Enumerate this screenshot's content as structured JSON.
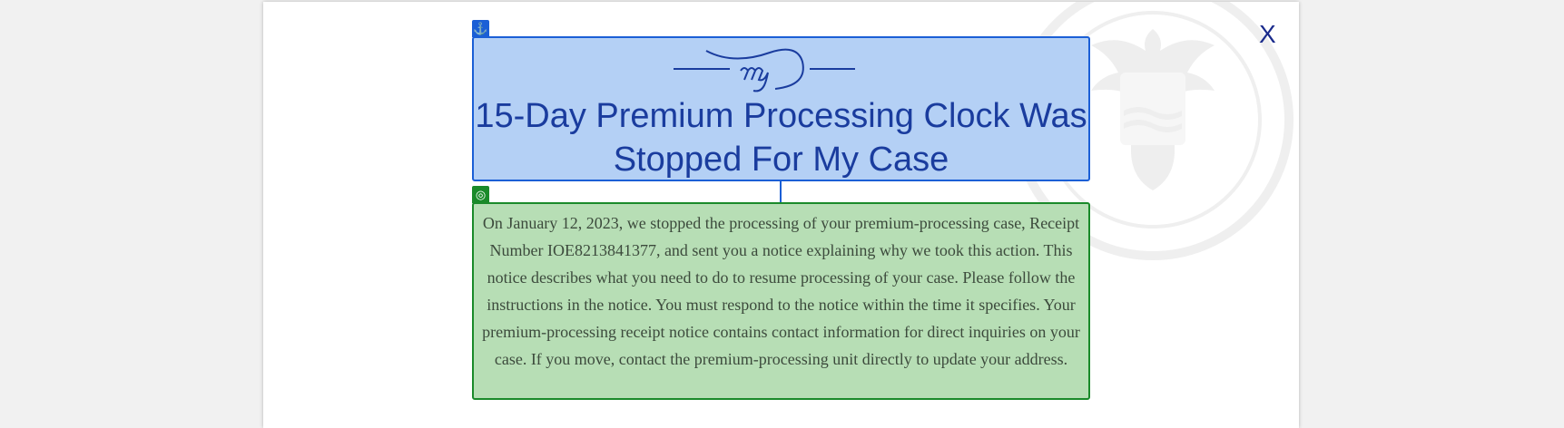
{
  "dialog": {
    "close_label": "X",
    "title": "15-Day Premium Processing Clock Was Stopped For My Case",
    "body": "On January 12, 2023, we stopped the processing of your premium-processing case, Receipt Number IOE8213841377, and sent you a notice explaining why we took this action. This notice describes what you need to do to resume processing of your case. Please follow the instructions in the notice. You must respond to the notice within the time it specifies. Your premium-processing receipt notice contains contact information for direct inquiries on your case. If you move, contact the premium-processing unit directly to update your address.",
    "header_badge_icon": "anchor-icon",
    "body_badge_icon": "target-icon"
  },
  "colors": {
    "header_bg": "#b4d0f5",
    "header_border": "#1b5fd6",
    "title_text": "#1a3c9e",
    "body_bg": "#b7deb5",
    "body_border": "#1a8a2a",
    "body_text": "#3c4a3c"
  }
}
